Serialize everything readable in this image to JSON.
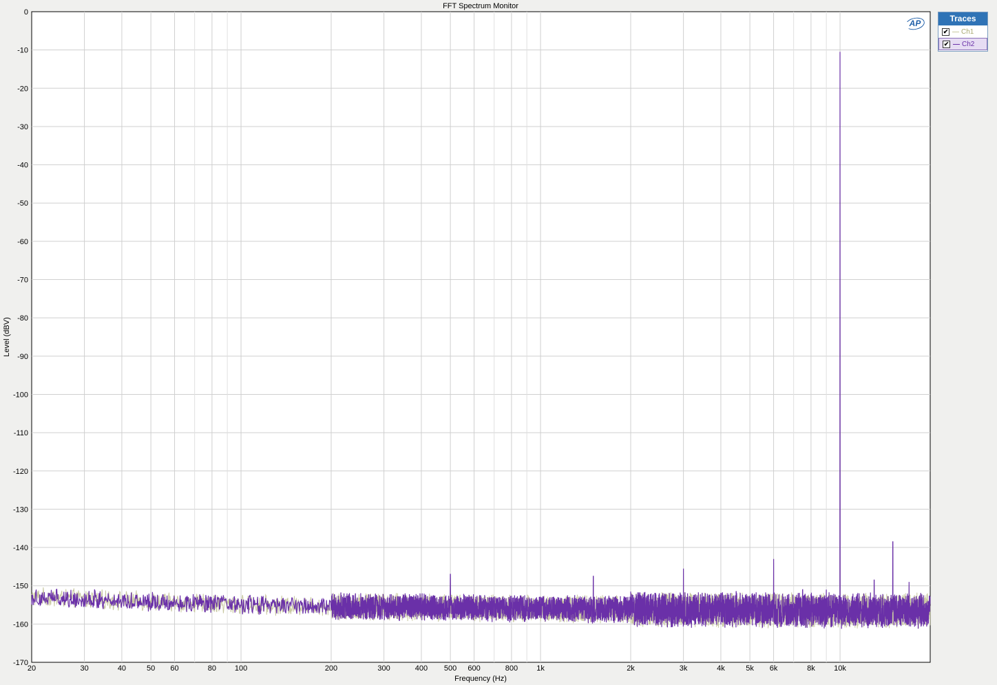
{
  "window": {
    "title": "FFT Spectrum Monitor"
  },
  "legend": {
    "title": "Traces",
    "items": [
      {
        "label": "Ch1",
        "checked": true,
        "color": "#c8c8a0",
        "check": "✔"
      },
      {
        "label": "Ch2",
        "checked": true,
        "color": "#6a30a8",
        "check": "✔"
      }
    ]
  },
  "logo": {
    "text": "AP"
  },
  "chart_data": {
    "type": "line",
    "title": "FFT Spectrum Monitor",
    "xlabel": "Frequency (Hz)",
    "ylabel": "Level (dBV)",
    "x_scale": "log",
    "xlim": [
      20,
      20000
    ],
    "ylim": [
      -170,
      0
    ],
    "grid": true,
    "legend_placement": "top-right outside",
    "x_ticks": [
      {
        "v": 20,
        "label": "20"
      },
      {
        "v": 30,
        "label": "30"
      },
      {
        "v": 40,
        "label": "40"
      },
      {
        "v": 50,
        "label": "50"
      },
      {
        "v": 60,
        "label": "60"
      },
      {
        "v": 80,
        "label": "80"
      },
      {
        "v": 100,
        "label": "100"
      },
      {
        "v": 200,
        "label": "200"
      },
      {
        "v": 300,
        "label": "300"
      },
      {
        "v": 400,
        "label": "400"
      },
      {
        "v": 500,
        "label": "500"
      },
      {
        "v": 600,
        "label": "600"
      },
      {
        "v": 800,
        "label": "800"
      },
      {
        "v": 1000,
        "label": "1k"
      },
      {
        "v": 2000,
        "label": "2k"
      },
      {
        "v": 3000,
        "label": "3k"
      },
      {
        "v": 4000,
        "label": "4k"
      },
      {
        "v": 5000,
        "label": "5k"
      },
      {
        "v": 6000,
        "label": "6k"
      },
      {
        "v": 8000,
        "label": "8k"
      },
      {
        "v": 10000,
        "label": "10k"
      }
    ],
    "x_minor_grid": [
      70,
      90,
      700,
      900,
      7000,
      9000
    ],
    "y_ticks": [
      {
        "v": 0,
        "label": "0"
      },
      {
        "v": -10,
        "label": "-10"
      },
      {
        "v": -20,
        "label": "-20"
      },
      {
        "v": -30,
        "label": "-30"
      },
      {
        "v": -40,
        "label": "-40"
      },
      {
        "v": -50,
        "label": "-50"
      },
      {
        "v": -60,
        "label": "-60"
      },
      {
        "v": -70,
        "label": "-70"
      },
      {
        "v": -80,
        "label": "-80"
      },
      {
        "v": -90,
        "label": "-90"
      },
      {
        "v": -100,
        "label": "-100"
      },
      {
        "v": -110,
        "label": "-110"
      },
      {
        "v": -120,
        "label": "-120"
      },
      {
        "v": -130,
        "label": "-130"
      },
      {
        "v": -140,
        "label": "-140"
      },
      {
        "v": -150,
        "label": "-150"
      },
      {
        "v": -160,
        "label": "-160"
      },
      {
        "v": -170,
        "label": "-170"
      }
    ],
    "series": [
      {
        "name": "Ch1",
        "color": "#c8c8a0",
        "noise_floor": [
          [
            20,
            -153
          ],
          [
            100,
            -155
          ],
          [
            1000,
            -156
          ],
          [
            10000,
            -156.5
          ],
          [
            20000,
            -156.5
          ]
        ],
        "peaks": [
          [
            10000,
            -10.5
          ],
          [
            500,
            -148
          ],
          [
            1500,
            -148.5
          ],
          [
            3000,
            -146
          ],
          [
            6000,
            -144
          ],
          [
            15000,
            -140
          ],
          [
            13000,
            -150
          ],
          [
            17000,
            -150
          ]
        ]
      },
      {
        "name": "Ch2",
        "color": "#6a30a8",
        "noise_floor": [
          [
            20,
            -153
          ],
          [
            100,
            -155
          ],
          [
            1000,
            -156
          ],
          [
            10000,
            -156.5
          ],
          [
            20000,
            -156.5
          ]
        ],
        "peaks": [
          [
            10000,
            -10.5
          ],
          [
            500,
            -147
          ],
          [
            1500,
            -147.5
          ],
          [
            3000,
            -145.5
          ],
          [
            6000,
            -143
          ],
          [
            15000,
            -138.5
          ],
          [
            13000,
            -148.5
          ],
          [
            17000,
            -149
          ],
          [
            2000,
            -151.5
          ],
          [
            4500,
            -151.5
          ],
          [
            7500,
            -151
          ],
          [
            9000,
            -151
          ]
        ]
      }
    ]
  }
}
